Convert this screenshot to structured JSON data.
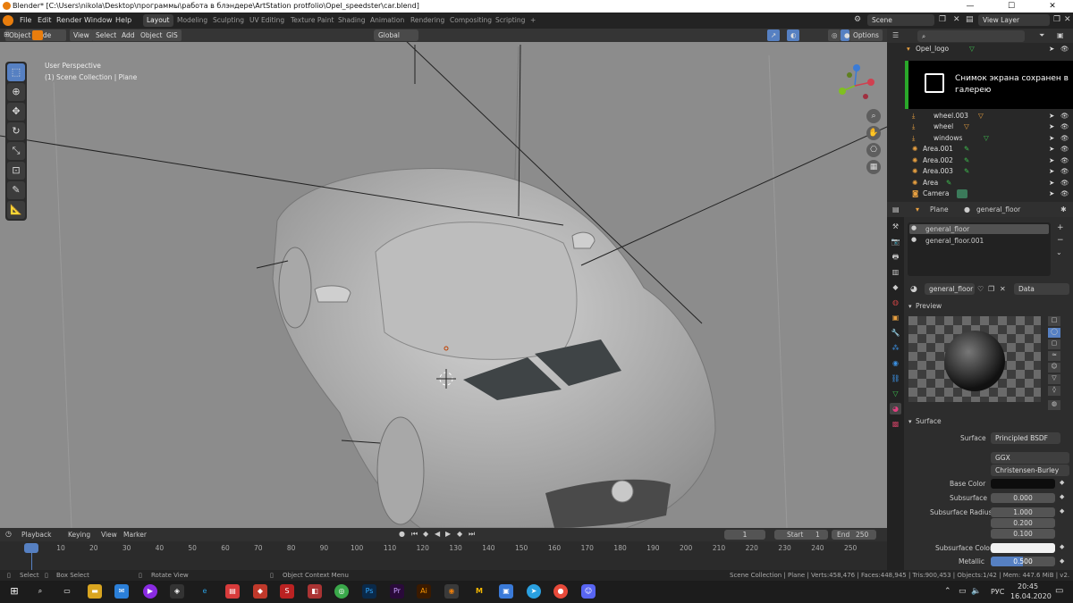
{
  "window": {
    "title": "Blender* [C:\\Users\\nikola\\Desktop\\программы\\работа в блэндере\\ArtStation protfolio\\Opel_speedster\\car.blend]",
    "minimize": "—",
    "maximize": "☐",
    "close": "✕"
  },
  "menu": [
    "File",
    "Edit",
    "Render",
    "Window",
    "Help"
  ],
  "workspaces": [
    "Layout",
    "Modeling",
    "Sculpting",
    "UV Editing",
    "Texture Paint",
    "Shading",
    "Animation",
    "Rendering",
    "Compositing",
    "Scripting",
    "+"
  ],
  "scene": {
    "scene_label": "Scene",
    "view_layer": "View Layer"
  },
  "viewport": {
    "mode": "Object Mode",
    "menus": [
      "View",
      "Select",
      "Add",
      "Object",
      "GIS"
    ],
    "transform": "Global",
    "options": "Options",
    "view_name": "User Perspective",
    "collection": "(1) Scene Collection | Plane"
  },
  "outliner": {
    "rows": [
      {
        "name": "Opel_logo",
        "top": "20"
      },
      {
        "name": "wheel.003",
        "top": "93"
      },
      {
        "name": "wheel",
        "top": "105"
      },
      {
        "name": "windows",
        "top": "118"
      },
      {
        "name": "Area.001",
        "top": "130"
      },
      {
        "name": "Area.002",
        "top": "143"
      },
      {
        "name": "Area.003",
        "top": "155"
      },
      {
        "name": "Area",
        "top": "168"
      },
      {
        "name": "Camera",
        "top": "180"
      }
    ],
    "toast": "Снимок экрана сохранен в галерею"
  },
  "properties": {
    "object": "Plane",
    "material": "general_floor",
    "slots": [
      "general_floor",
      "general_floor.001"
    ],
    "mat_field": "general_floor",
    "link": "Data",
    "preview": "Preview",
    "surface_panel": "Surface",
    "surface_label": "Surface",
    "surface_value": "Principled BSDF",
    "dist": "GGX",
    "sss_method": "Christensen-Burley",
    "base_color": "Base Color",
    "subsurface": "Subsurface",
    "subsurface_value": "0.000",
    "subsurface_radius": "Subsurface Radius",
    "sr1": "1.000",
    "sr2": "0.200",
    "sr3": "0.100",
    "subsurface_color": "Subsurface Color",
    "metallic": "Metallic",
    "metallic_value": "0.500"
  },
  "timeline": {
    "menus": [
      "Playback",
      "Keying",
      "View",
      "Marker"
    ],
    "frame": "1",
    "start_label": "Start",
    "start": "1",
    "end_label": "End",
    "end": "250",
    "ticks": [
      "1",
      "10",
      "20",
      "30",
      "40",
      "50",
      "60",
      "70",
      "80",
      "90",
      "100",
      "110",
      "120",
      "130",
      "140",
      "150",
      "160",
      "170",
      "180",
      "190",
      "200",
      "210",
      "220",
      "230",
      "240",
      "250"
    ]
  },
  "status": {
    "select": "Select",
    "box": "Box Select",
    "rotate": "Rotate View",
    "context": "Object Context Menu",
    "stats": "Scene Collection | Plane | Verts:458,476 | Faces:448,945 | Tris:900,453 | Objects:1/42 | Mem: 447.6 MiB | v2.81.16"
  },
  "taskbar": {
    "lang": "РУС",
    "time": "20:45",
    "date": "16.04.2020"
  },
  "colors": {
    "accent": "#5680c2",
    "toast_border": "#2aa82a",
    "viewport_bg": "#8c8c8c"
  }
}
